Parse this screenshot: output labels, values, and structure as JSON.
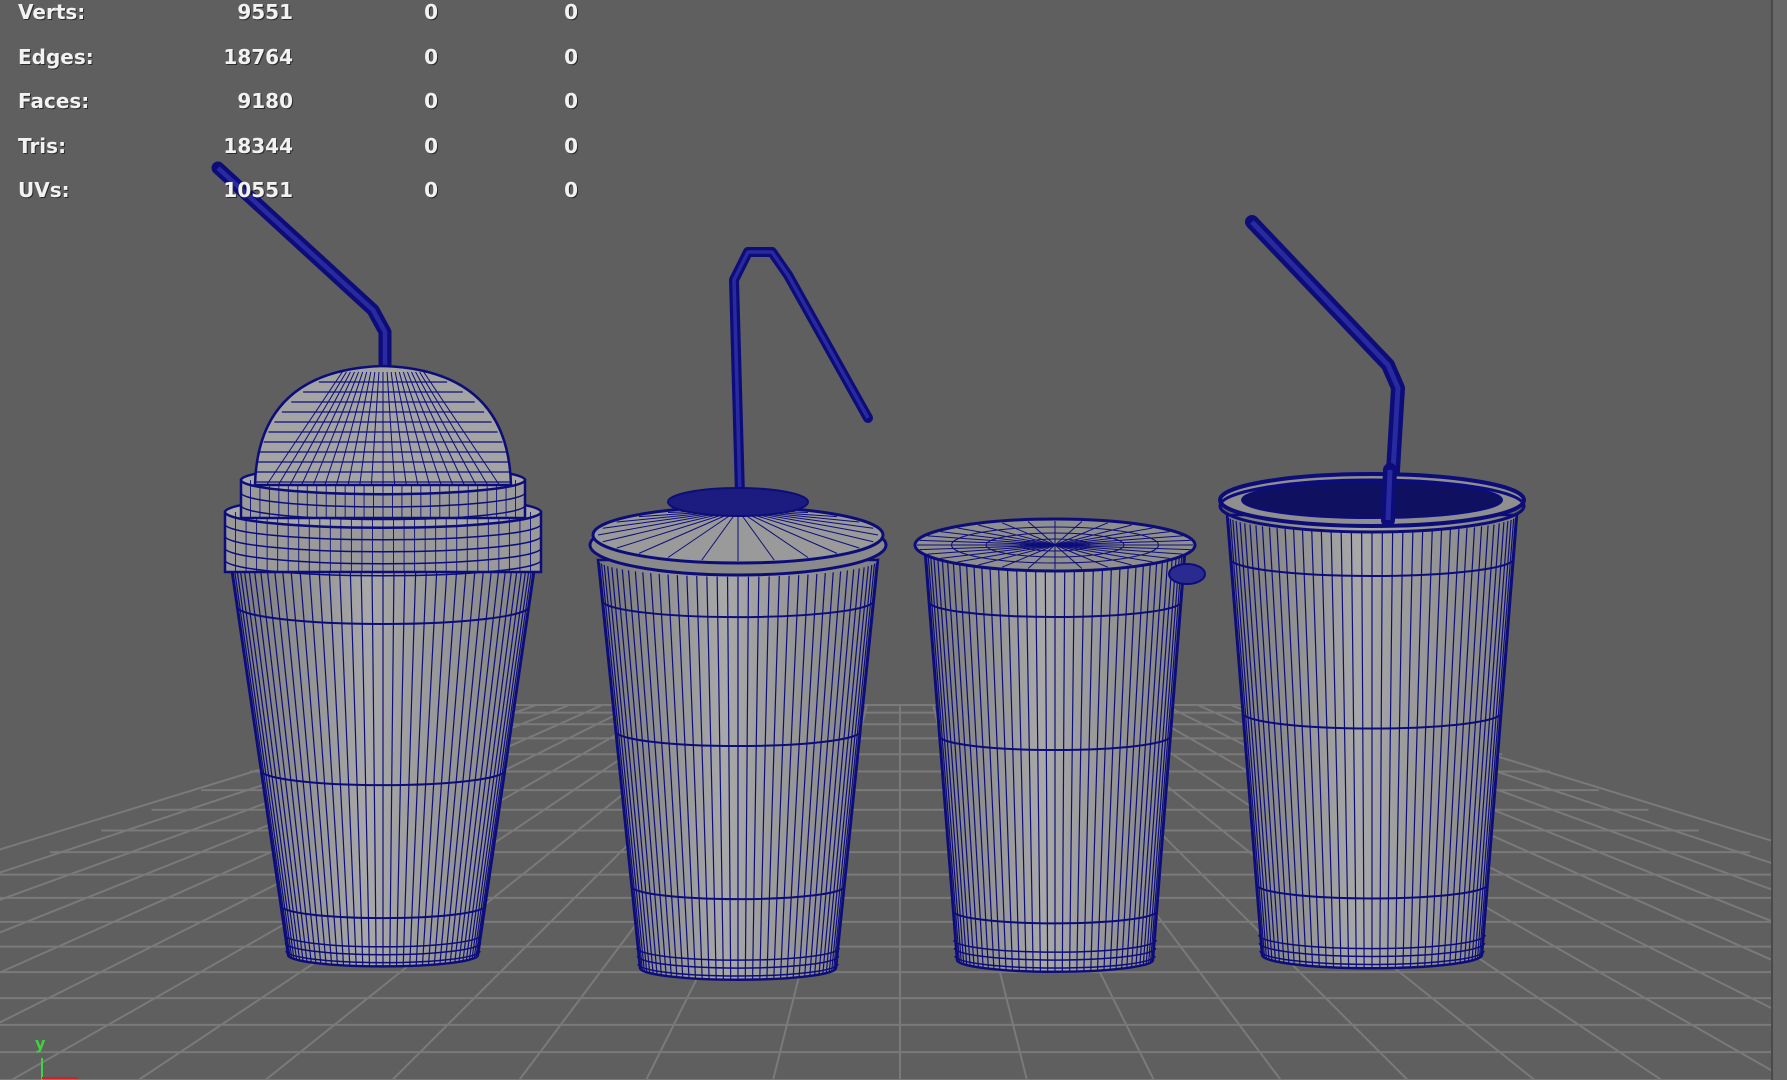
{
  "hud": {
    "rows": [
      {
        "label": "Verts:",
        "v1": "9551",
        "v2": "0",
        "v3": "0"
      },
      {
        "label": "Edges:",
        "v1": "18764",
        "v2": "0",
        "v3": "0"
      },
      {
        "label": "Faces:",
        "v1": "9180",
        "v2": "0",
        "v3": "0"
      },
      {
        "label": "Tris:",
        "v1": "18344",
        "v2": "0",
        "v3": "0"
      },
      {
        "label": "UVs:",
        "v1": "10551",
        "v2": "0",
        "v3": "0"
      }
    ]
  },
  "axis": {
    "y_label": "y",
    "x_color": "#d42020",
    "y_color": "#3fd43f"
  },
  "colors": {
    "background": "#5f5f5f",
    "wire": "#0d0d7a",
    "mesh": "#9c9c9c",
    "grid": "#787878"
  },
  "objects": [
    "dome-lid-cup",
    "flat-lid-cup",
    "sealed-cup",
    "open-cup"
  ]
}
